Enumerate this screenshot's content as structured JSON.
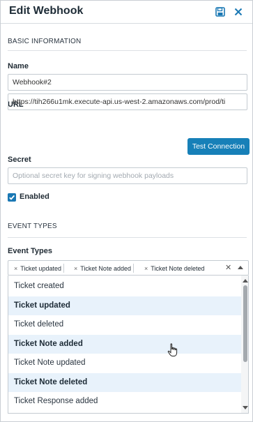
{
  "header": {
    "title": "Edit Webhook",
    "save_icon": "save-icon",
    "close_icon": "close-icon",
    "accent_color": "#1a78b4"
  },
  "basic_information": {
    "section_title": "BASIC INFORMATION",
    "name_label": "Name",
    "name_value": "Webhook#2",
    "url_label": "URL",
    "url_value": "https://tih266u1mk.execute-api.us-west-2.amazonaws.com/prod/ti",
    "test_connection_label": "Test Connection",
    "secret_label": "Secret",
    "secret_placeholder": "Optional secret key for signing webhook payloads",
    "enabled_label": "Enabled",
    "enabled_checked": true
  },
  "event_types": {
    "section_title": "EVENT TYPES",
    "field_label": "Event Types",
    "selected_chips": [
      "Ticket updated",
      "Ticket Note added",
      "Ticket Note deleted"
    ],
    "options": [
      {
        "label": "Ticket created",
        "selected": false
      },
      {
        "label": "Ticket updated",
        "selected": true
      },
      {
        "label": "Ticket deleted",
        "selected": false
      },
      {
        "label": "Ticket Note added",
        "selected": true
      },
      {
        "label": "Ticket Note updated",
        "selected": false
      },
      {
        "label": "Ticket Note deleted",
        "selected": true
      },
      {
        "label": "Ticket Response added",
        "selected": false
      }
    ]
  }
}
